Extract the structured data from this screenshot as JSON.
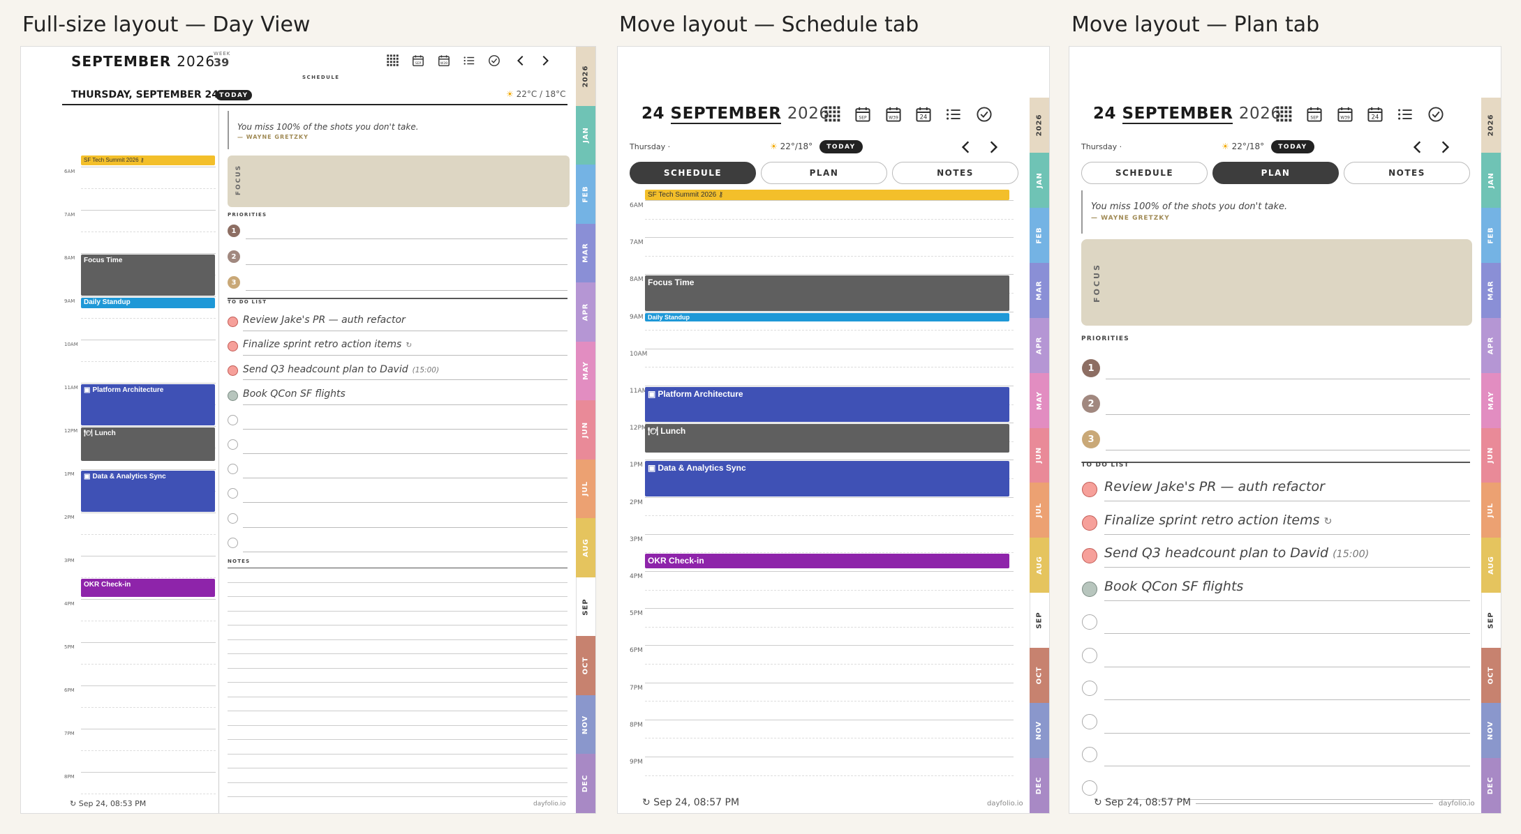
{
  "captions": {
    "full": "Full-size layout — Day View",
    "schedule": "Move layout — Schedule tab",
    "plan": "Move layout — Plan tab"
  },
  "months": [
    "JAN",
    "FEB",
    "MAR",
    "APR",
    "MAY",
    "JUN",
    "JUL",
    "AUG",
    "SEP",
    "OCT",
    "NOV",
    "DEC"
  ],
  "year_tab": "2026",
  "colors": {
    "focus_event": "#5f5f5f",
    "standup": "#1e98d7",
    "meeting": "#3f51b5",
    "okr": "#8e24aa",
    "allday": "#f3bf2a",
    "focus_box": "#ddd6c3",
    "prio1": "#8d6e63",
    "prio2": "#a1887f",
    "prio3": "#c9a877"
  },
  "icons": [
    "grid-icon",
    "calendar-month-icon",
    "calendar-week-icon",
    "calendar-day-icon",
    "list-icon",
    "check-circle-icon",
    "chevron-left-icon",
    "chevron-right-icon",
    "sun-icon",
    "sync-icon"
  ],
  "full": {
    "month": "SEPTEMBER",
    "year": "2026",
    "week_label": "WEEK",
    "week_num": "39",
    "schedule_label": "SCHEDULE",
    "date_heading": "THURSDAY, SEPTEMBER 24",
    "today": "TODAY",
    "weather": "22°C / 18°C",
    "quote": "You miss 100% of the shots you don't take.",
    "author": "— WAYNE GRETZKY",
    "focus": "FOCUS",
    "priorities_label": "PRIORITIES",
    "todo_label": "TO DO LIST",
    "notes_label": "NOTES",
    "sync": "Sep 24, 08:53 PM",
    "brand": "dayfolio.io"
  },
  "move": {
    "day": "24",
    "month": "SEPTEMBER",
    "year": "2026",
    "weekday": "Thursday",
    "weekday_sep": "·",
    "weather": "22°/18°",
    "today": "TODAY",
    "tabs": [
      "SCHEDULE",
      "PLAN",
      "NOTES"
    ],
    "icon_month": "SEP",
    "icon_week": "W39",
    "icon_day": "24",
    "sync_schedule": "Sep 24, 08:57 PM",
    "sync_plan": "Sep 24, 08:57 PM",
    "brand": "dayfolio.io"
  },
  "hours": [
    "6AM",
    "7AM",
    "8AM",
    "9AM",
    "10AM",
    "11AM",
    "12PM",
    "1PM",
    "2PM",
    "3PM",
    "4PM",
    "5PM",
    "6PM",
    "7PM",
    "8PM",
    "9PM"
  ],
  "allday_event": "SF Tech Summit 2026",
  "events": [
    {
      "title": "Focus Time"
    },
    {
      "title": "Daily Standup"
    },
    {
      "title": "Platform Architecture"
    },
    {
      "title": "Lunch"
    },
    {
      "title": "Data & Analytics Sync"
    },
    {
      "title": "OKR Check-in"
    }
  ],
  "priorities": [
    "1",
    "2",
    "3"
  ],
  "todos": [
    {
      "text": "Review Jake's PR — auth refactor",
      "state": "open"
    },
    {
      "text": "Finalize sprint retro action items",
      "suffix": "↻",
      "state": "open"
    },
    {
      "text": "Send Q3 headcount plan to David",
      "suffix": "(15:00)",
      "state": "open"
    },
    {
      "text": "Book QCon SF flights",
      "state": "done"
    }
  ]
}
